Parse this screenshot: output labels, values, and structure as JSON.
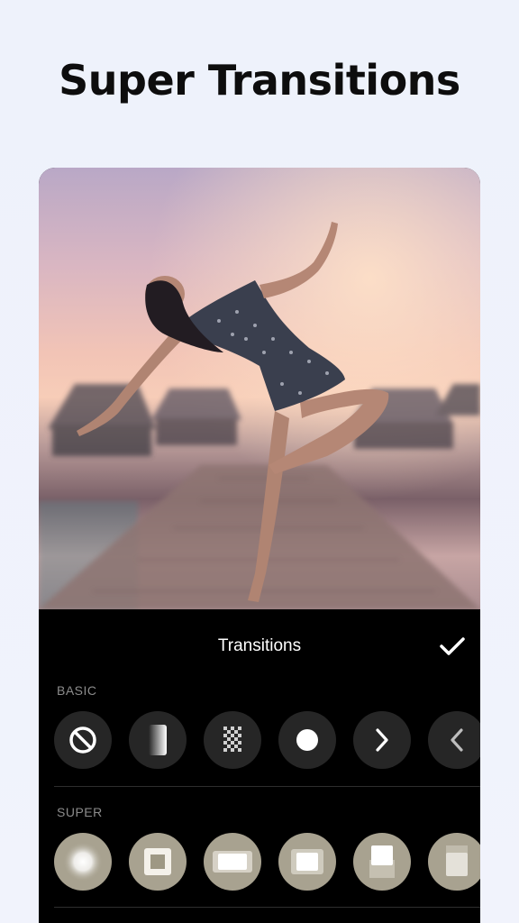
{
  "headline": "Super Transitions",
  "panel": {
    "title": "Transitions",
    "sections": {
      "basic": {
        "label": "BASIC",
        "items": [
          {
            "name": "none",
            "icon": "no-transition-icon"
          },
          {
            "name": "gradient-fade",
            "icon": "gradient-fade-icon"
          },
          {
            "name": "dissolve",
            "icon": "dissolve-icon"
          },
          {
            "name": "circle",
            "icon": "circle-icon"
          },
          {
            "name": "slide-right",
            "icon": "chevron-right-icon"
          },
          {
            "name": "slide-left",
            "icon": "chevron-left-icon"
          }
        ]
      },
      "super": {
        "label": "SUPER",
        "items": [
          {
            "name": "super-1",
            "icon": "zoom-glow-icon"
          },
          {
            "name": "super-2",
            "icon": "frame-zoom-icon"
          },
          {
            "name": "super-3",
            "icon": "wide-glow-icon"
          },
          {
            "name": "super-4",
            "icon": "square-glow-icon"
          },
          {
            "name": "super-5",
            "icon": "slide-glow-icon"
          },
          {
            "name": "super-6",
            "icon": "blur-bar-icon"
          }
        ]
      }
    }
  },
  "colors": {
    "page_background": "#eef2fb",
    "panel_background": "#000000",
    "button_background": "#262626",
    "super_button_background": "#a8a290",
    "label_color": "#8c8c8c"
  }
}
